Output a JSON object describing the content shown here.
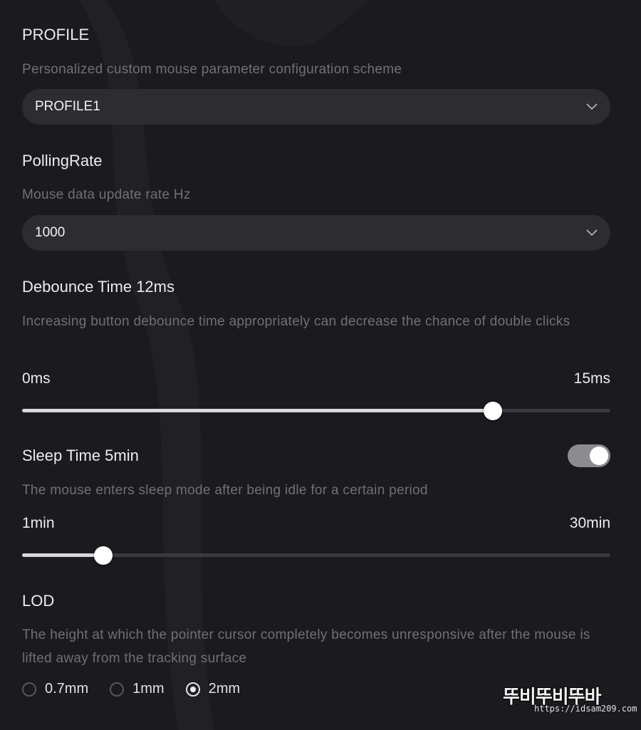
{
  "profile": {
    "title": "PROFILE",
    "description": "Personalized custom mouse parameter configuration scheme",
    "selected": "PROFILE1"
  },
  "polling_rate": {
    "title": "PollingRate",
    "description": "Mouse data update rate Hz",
    "selected": "1000"
  },
  "debounce": {
    "title": "Debounce Time 12ms",
    "description": "Increasing button debounce time appropriately can decrease the chance of double clicks",
    "min_label": "0ms",
    "max_label": "15ms",
    "value": 12,
    "min": 0,
    "max": 15
  },
  "sleep": {
    "title": "Sleep Time 5min",
    "description": "The mouse enters sleep mode after being idle for a certain period",
    "enabled": true,
    "min_label": "1min",
    "max_label": "30min",
    "value": 5,
    "min": 1,
    "max": 30
  },
  "lod": {
    "title": "LOD",
    "description": "The height at which the pointer cursor completely becomes unresponsive after the mouse is lifted away from the tracking surface",
    "options": [
      "0.7mm",
      "1mm",
      "2mm"
    ],
    "selected_index": 2
  },
  "watermark": {
    "logo": "뚜비뚜비뚜바",
    "url": "https://idsam209.com"
  },
  "icons": {
    "dropdown": "chevron-down-icon"
  },
  "colors": {
    "background": "#1b1b1f",
    "accent": "#ffffff",
    "muted_text": "#6f6f76"
  }
}
